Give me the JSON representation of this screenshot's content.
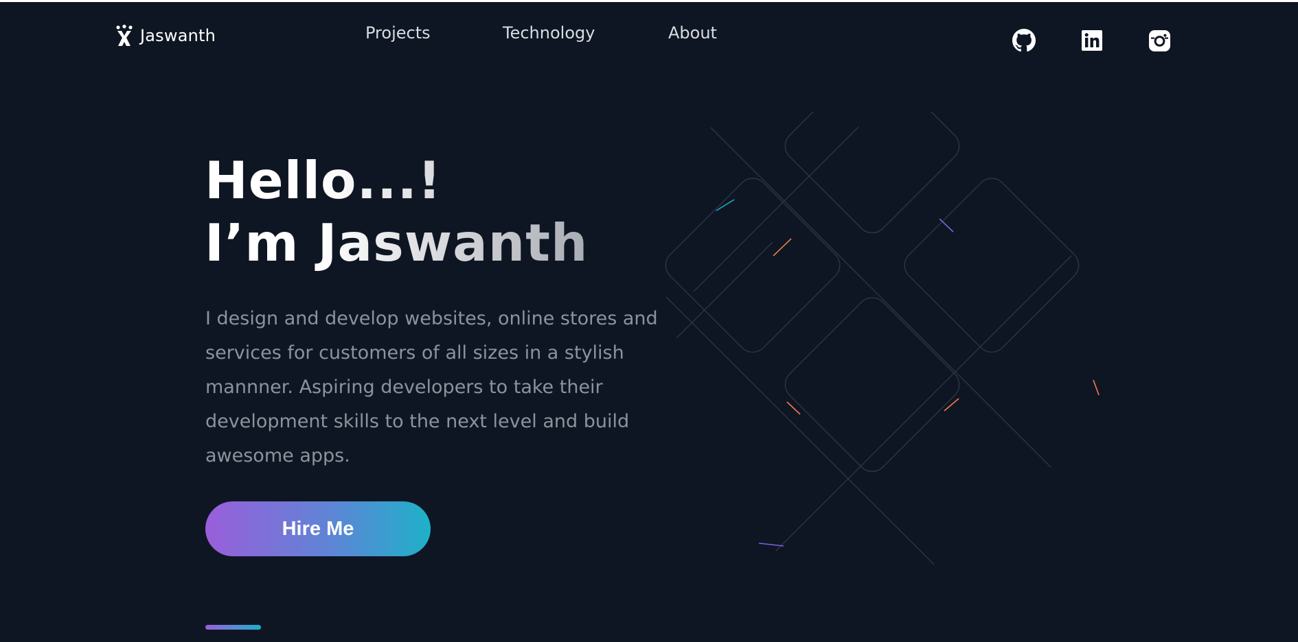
{
  "brand": {
    "name": "Jaswanth"
  },
  "nav": {
    "links": [
      "Projects",
      "Technology",
      "About"
    ]
  },
  "social": {
    "icons": [
      "github-icon",
      "linkedin-icon",
      "instagram-icon"
    ]
  },
  "hero": {
    "greeting": "Hello...!",
    "name_line": "I’m Jaswanth",
    "description": "I design and develop websites, online stores and services for customers of all sizes in a stylish mannner. Aspiring developers to take their development skills to the next level and build awesome apps.",
    "cta_label": "Hire Me"
  },
  "colors": {
    "background": "#0f1623",
    "accent_start": "#9a5edb",
    "accent_end": "#1eb1c9",
    "nav_text": "#d9dce3",
    "body_text": "#8d939d"
  }
}
